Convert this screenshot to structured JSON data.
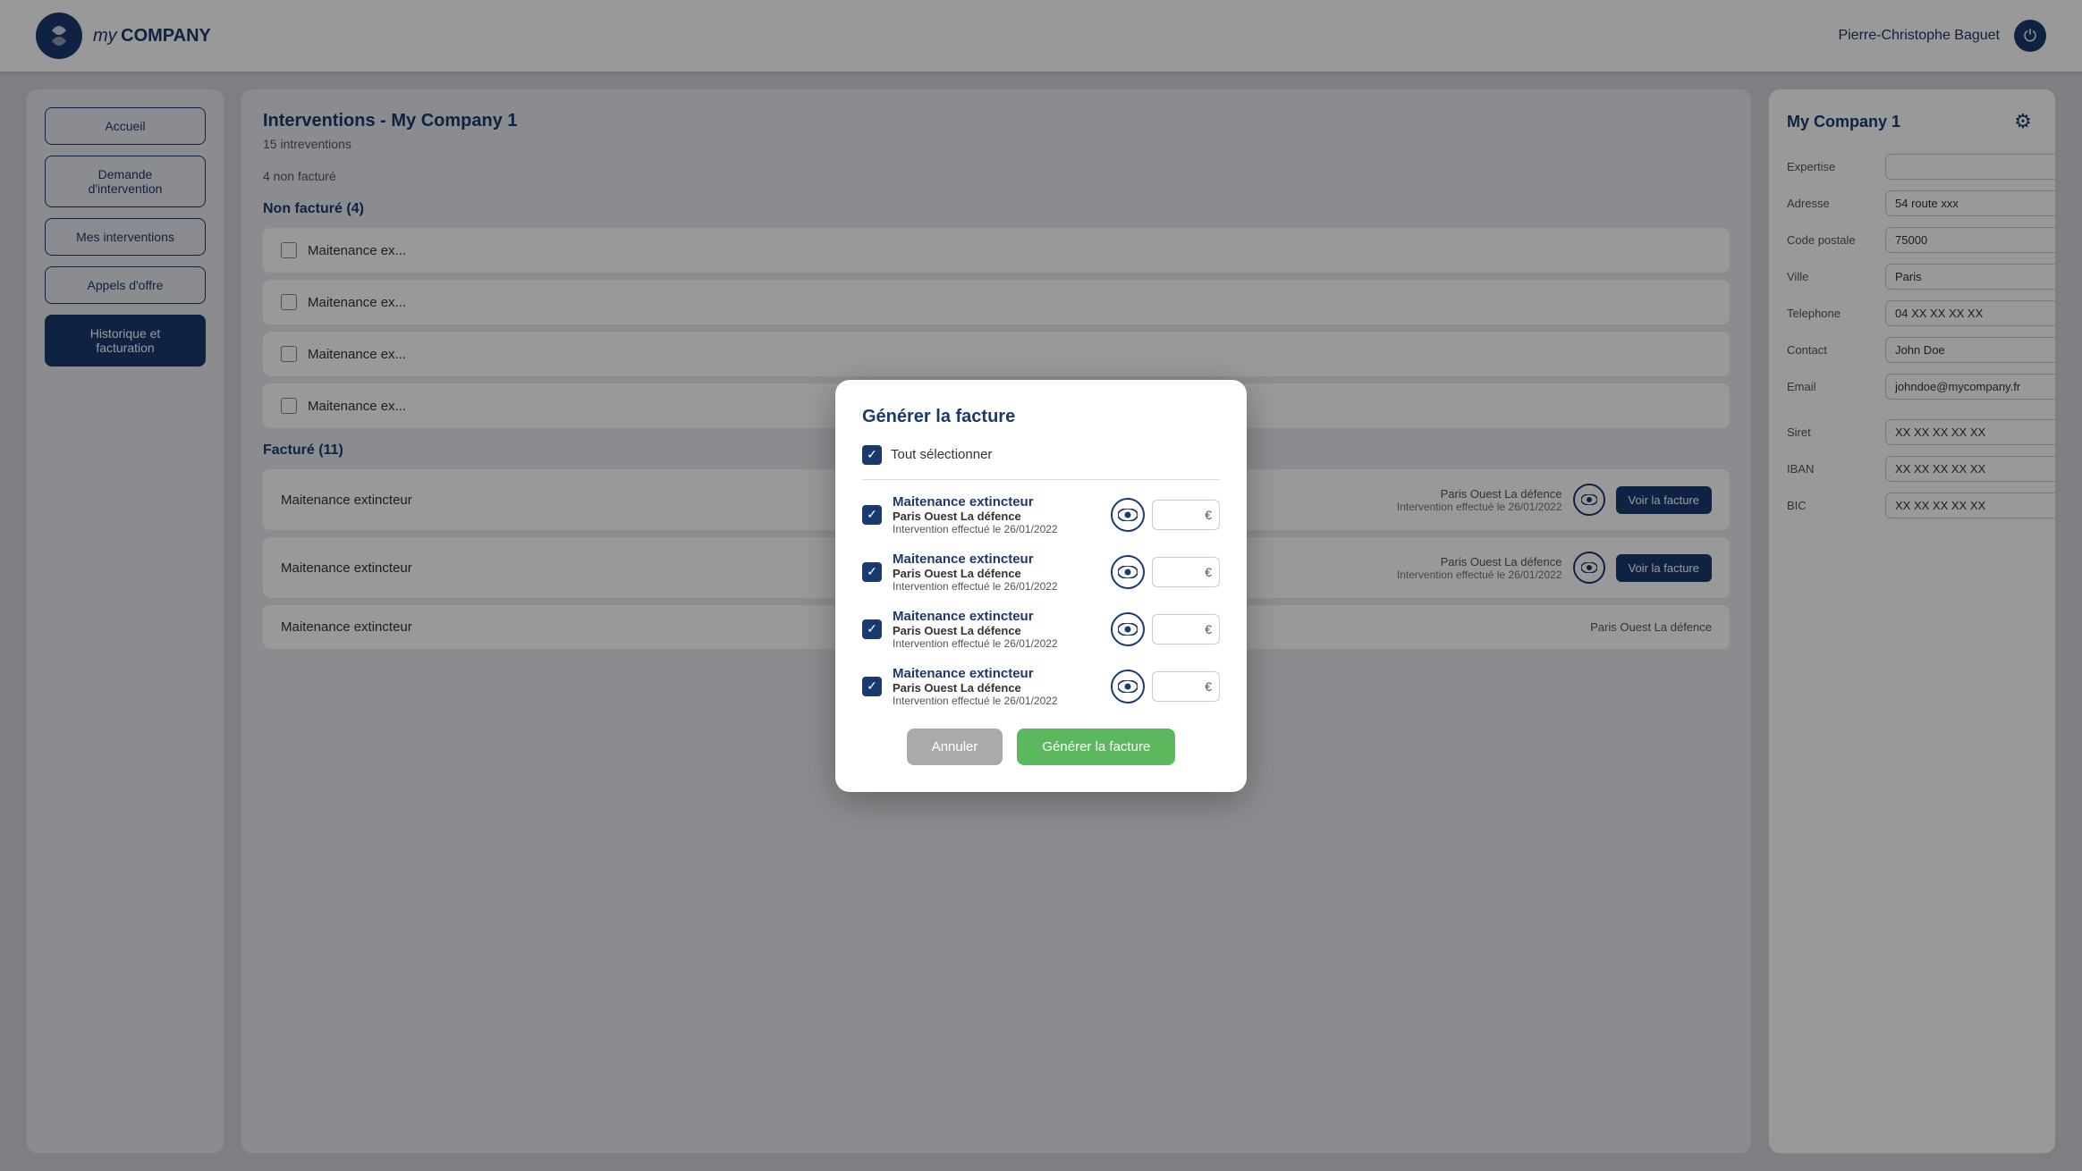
{
  "header": {
    "logo_company": "COMPANY",
    "logo_my": "my",
    "user_name": "Pierre-Christophe Baguet"
  },
  "sidebar": {
    "buttons": [
      {
        "id": "accueil",
        "label": "Accueil",
        "active": false
      },
      {
        "id": "demande",
        "label": "Demande d'intervention",
        "active": false
      },
      {
        "id": "mes-interventions",
        "label": "Mes interventions",
        "active": false
      },
      {
        "id": "appels",
        "label": "Appels d'offre",
        "active": false
      },
      {
        "id": "historique",
        "label": "Historique et facturation",
        "active": true
      }
    ]
  },
  "content": {
    "page_title": "Interventions - My Company 1",
    "stats_line1": "15 intreventions",
    "stats_line2": "4 non facturé",
    "non_facture_header": "Non facturé (4)",
    "non_facture_rows": [
      {
        "label": "Maitenance ex..."
      },
      {
        "label": "Maitenance ex..."
      },
      {
        "label": "Maitenance ex..."
      },
      {
        "label": "Maitenance ex..."
      }
    ],
    "facture_header": "Facturé (11)",
    "facture_rows": [
      {
        "label": "Maitenance extincteur",
        "location": "Paris Ouest La défence",
        "date": "Intervention effectué le 26/01/2022",
        "btn": "Voir la facture"
      },
      {
        "label": "Maitenance extincteur",
        "location": "Paris Ouest La défence",
        "date": "Intervention effectué le 26/01/2022",
        "btn": "Voir la facture"
      },
      {
        "label": "Maitenance extincteur",
        "location": "Paris Ouest La défence"
      }
    ]
  },
  "modal": {
    "title": "Générer la facture",
    "select_all_label": "Tout sélectionner",
    "items": [
      {
        "name": "Maitenance extincteur",
        "location": "Paris Ouest La défence",
        "date": "Intervention effectué le 26/01/2022",
        "checked": true,
        "price": ""
      },
      {
        "name": "Maitenance extincteur",
        "location": "Paris Ouest La défence",
        "date": "Intervention effectué le 26/01/2022",
        "checked": true,
        "price": ""
      },
      {
        "name": "Maitenance extincteur",
        "location": "Paris Ouest La défence",
        "date": "Intervention effectué le 26/01/2022",
        "checked": true,
        "price": ""
      },
      {
        "name": "Maitenance extincteur",
        "location": "Paris Ouest La défence",
        "date": "Intervention effectué le 26/01/2022",
        "checked": true,
        "price": ""
      }
    ],
    "btn_annuler": "Annuler",
    "btn_generer": "Générer la facture"
  },
  "right_panel": {
    "title": "My Company 1",
    "fields": [
      {
        "label": "Expertise",
        "value": "",
        "placeholder": ""
      },
      {
        "label": "Adresse",
        "value": "54 route xxx",
        "placeholder": ""
      },
      {
        "label": "Code postale",
        "value": "75000",
        "placeholder": ""
      },
      {
        "label": "Ville",
        "value": "Paris",
        "placeholder": ""
      },
      {
        "label": "Telephone",
        "value": "04 XX XX XX XX",
        "placeholder": ""
      },
      {
        "label": "Contact",
        "value": "John Doe",
        "placeholder": ""
      },
      {
        "label": "Email",
        "value": "johndoe@mycompany.fr",
        "placeholder": ""
      },
      {
        "label": "Siret",
        "value": "XX XX XX XX XX",
        "placeholder": ""
      },
      {
        "label": "IBAN",
        "value": "XX XX XX XX XX",
        "placeholder": ""
      },
      {
        "label": "BIC",
        "value": "XX XX XX XX XX",
        "placeholder": ""
      }
    ]
  }
}
